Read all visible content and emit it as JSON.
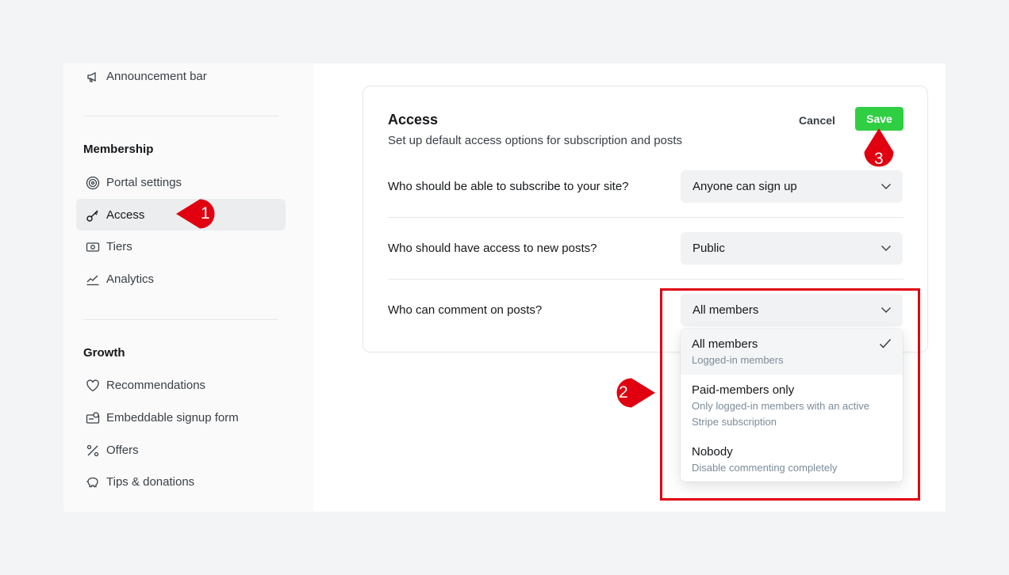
{
  "sidebar": {
    "top_item": {
      "label": "Announcement bar",
      "icon": "megaphone-icon"
    },
    "membership": {
      "title": "Membership",
      "items": [
        {
          "label": "Portal settings",
          "icon": "portal-icon"
        },
        {
          "label": "Access",
          "icon": "key-icon",
          "active": true
        },
        {
          "label": "Tiers",
          "icon": "tiers-icon"
        },
        {
          "label": "Analytics",
          "icon": "analytics-icon"
        }
      ]
    },
    "growth": {
      "title": "Growth",
      "items": [
        {
          "label": "Recommendations",
          "icon": "heart-icon"
        },
        {
          "label": "Embeddable signup form",
          "icon": "signup-form-icon"
        },
        {
          "label": "Offers",
          "icon": "percent-icon"
        },
        {
          "label": "Tips & donations",
          "icon": "piggy-bank-icon"
        }
      ]
    }
  },
  "card": {
    "title": "Access",
    "subtitle": "Set up default access options for subscription and posts",
    "cancel_label": "Cancel",
    "save_label": "Save",
    "rows": [
      {
        "label": "Who should be able to subscribe to your site?",
        "value": "Anyone can sign up"
      },
      {
        "label": "Who should have access to new posts?",
        "value": "Public"
      },
      {
        "label": "Who can comment on posts?",
        "value": "All members"
      }
    ]
  },
  "dropdown": {
    "options": [
      {
        "title": "All members",
        "desc": "Logged-in members",
        "selected": true
      },
      {
        "title": "Paid-members only",
        "desc": "Only logged-in members with an active Stripe subscription"
      },
      {
        "title": "Nobody",
        "desc": "Disable commenting completely"
      }
    ]
  },
  "annotations": {
    "step1": "1",
    "step2": "2",
    "step3": "3",
    "marker_color": "#e00010",
    "highlight_color": "#e00010"
  },
  "colors": {
    "save_button": "#30cf43",
    "page_background": "#f3f4f6"
  }
}
